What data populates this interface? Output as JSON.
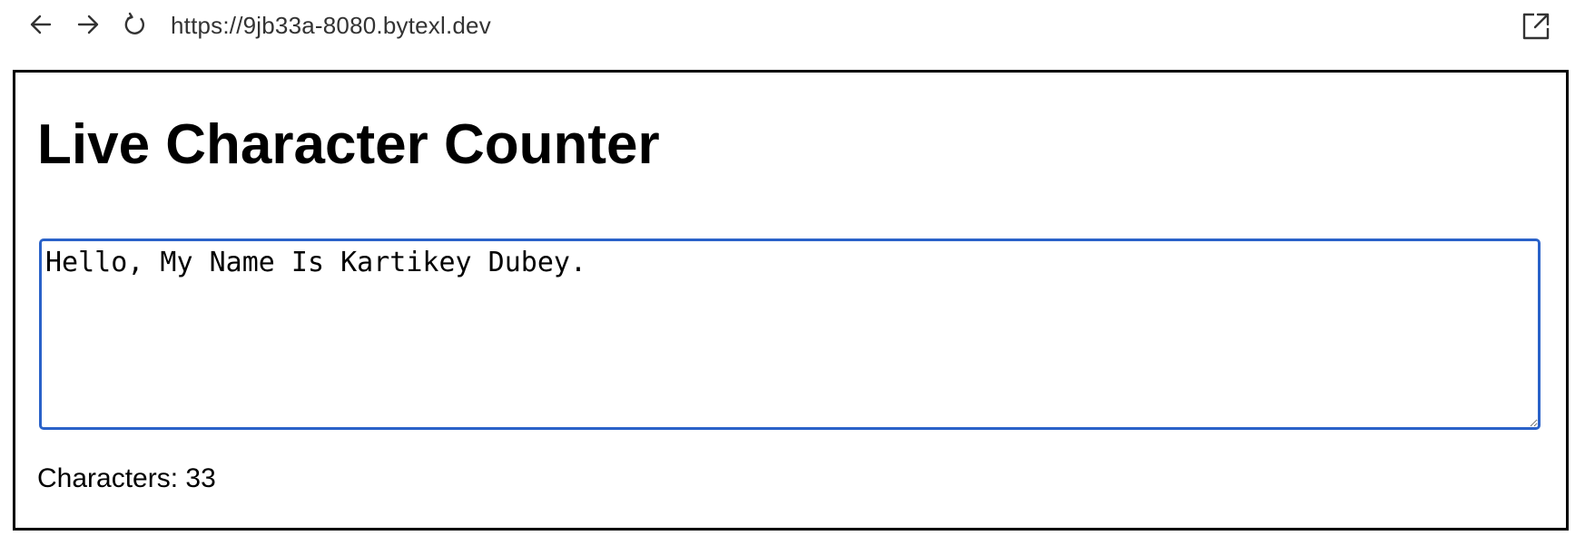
{
  "browser": {
    "url": "https://9jb33a-8080.bytexl.dev",
    "icons": {
      "back": "arrow-left-icon",
      "forward": "arrow-right-icon",
      "reload": "reload-icon",
      "open_external": "open-external-icon"
    }
  },
  "page": {
    "title": "Live Character Counter",
    "textarea": {
      "value": "Hello, My Name Is Kartikey Dubey.",
      "focused": true
    },
    "counter": {
      "label": "Characters:",
      "value": "33"
    }
  },
  "colors": {
    "focus_border": "#2a62c9",
    "frame_border": "#000000"
  }
}
